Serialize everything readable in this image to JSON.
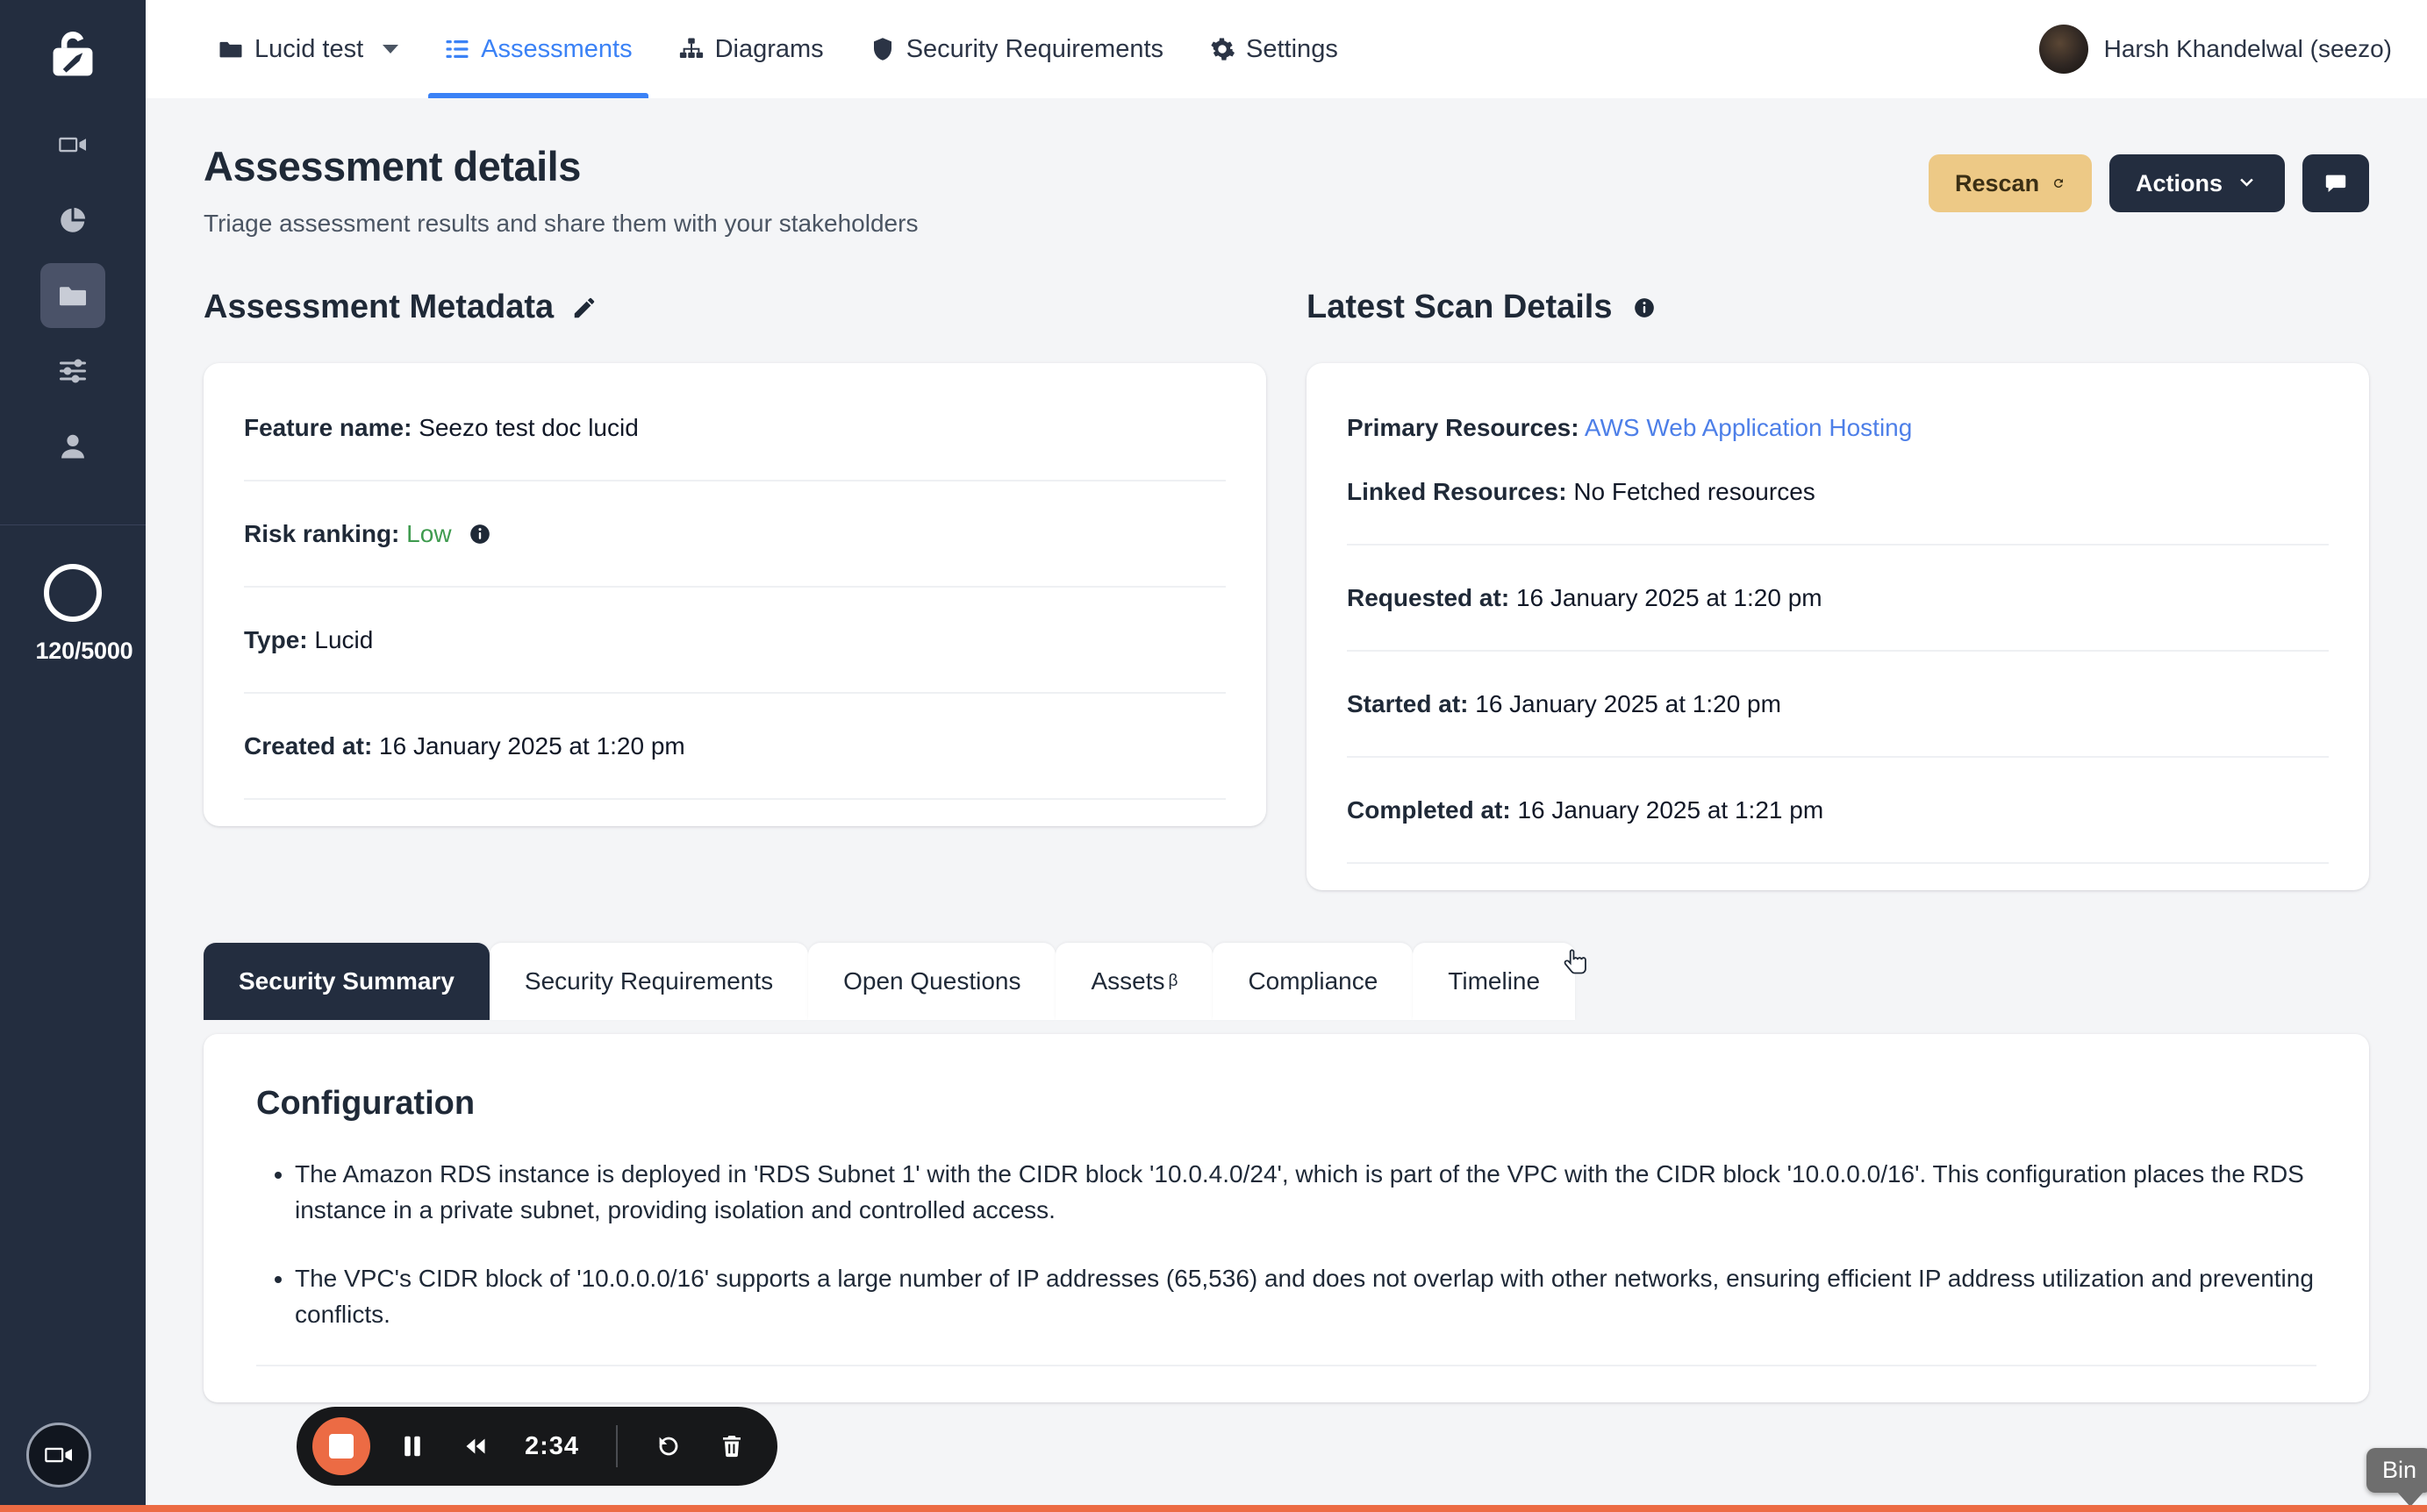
{
  "sidebar": {
    "logo_icon": "lock-compass-logo",
    "items": [
      {
        "icon": "video-camera-icon",
        "name": "recordings",
        "active": false
      },
      {
        "icon": "pie-chart-icon",
        "name": "analytics",
        "active": false
      },
      {
        "icon": "folder-icon",
        "name": "projects",
        "active": true
      },
      {
        "icon": "sliders-icon",
        "name": "settings-controls",
        "active": false
      },
      {
        "icon": "person-icon",
        "name": "account",
        "active": false
      }
    ],
    "quota_label": "120/5000"
  },
  "topbar": {
    "workspace": "Lucid test",
    "nav": [
      {
        "label": "Assessments",
        "icon": "list-icon",
        "active": true
      },
      {
        "label": "Diagrams",
        "icon": "sitemap-icon",
        "active": false
      },
      {
        "label": "Security Requirements",
        "icon": "shield-icon",
        "active": false
      },
      {
        "label": "Settings",
        "icon": "gear-icon",
        "active": false
      }
    ],
    "user_name": "Harsh Khandelwal (seezo)"
  },
  "page": {
    "title": "Assessment details",
    "subtitle": "Triage assessment results and share them with your stakeholders",
    "actions": {
      "rescan_label": "Rescan",
      "actions_label": "Actions",
      "chat_icon": "chat-bubble-icon"
    }
  },
  "metadata": {
    "heading": "Assessment Metadata",
    "edit_icon": "edit-pencil-icon",
    "rows": [
      {
        "label": "Feature name:",
        "value": "Seezo test doc lucid",
        "style": "plain"
      },
      {
        "label": "Risk ranking:",
        "value": "Low",
        "style": "low",
        "info": true
      },
      {
        "label": "Type:",
        "value": "Lucid",
        "style": "plain"
      },
      {
        "label": "Created at:",
        "value": "16 January 2025 at 1:20 pm",
        "style": "plain"
      }
    ]
  },
  "scan": {
    "heading": "Latest Scan Details",
    "info_icon": "info-icon",
    "rows": [
      {
        "label": "Primary Resources:",
        "value": "AWS Web Application Hosting",
        "style": "link"
      },
      {
        "label": "Linked Resources:",
        "value": "No Fetched resources",
        "style": "plain"
      },
      {
        "label": "Requested at:",
        "value": "16 January 2025 at 1:20 pm",
        "style": "plain"
      },
      {
        "label": "Started at:",
        "value": "16 January 2025 at 1:20 pm",
        "style": "plain"
      },
      {
        "label": "Completed at:",
        "value": "16 January 2025 at 1:21 pm",
        "style": "plain"
      }
    ]
  },
  "tabs": [
    {
      "label": "Security Summary",
      "active": true
    },
    {
      "label": "Security Requirements",
      "active": false
    },
    {
      "label": "Assets",
      "sup": "β",
      "active": false
    },
    {
      "label": "Open Questions",
      "active": false
    },
    {
      "label": "Compliance",
      "active": false
    },
    {
      "label": "Timeline",
      "active": false
    }
  ],
  "tab_order": [
    "Security Summary",
    "Security Requirements",
    "Open Questions",
    "Assets",
    "Compliance",
    "Timeline"
  ],
  "content": {
    "title": "Configuration",
    "bullets": [
      "The Amazon RDS instance is deployed in 'RDS Subnet 1' with the CIDR block '10.0.4.0/24', which is part of the VPC with the CIDR block '10.0.0.0/16'. This configuration places the RDS instance in a private subnet, providing isolation and controlled access.",
      "The VPC's CIDR block of '10.0.0.0/16' supports a large number of IP addresses (65,536) and does not overlap with other networks, ensuring efficient IP address utilization and preventing conflicts."
    ]
  },
  "recorder": {
    "stop_icon": "stop-icon",
    "pause_icon": "pause-icon",
    "rewind_icon": "rewind-icon",
    "time": "2:34",
    "restart_icon": "restart-icon",
    "delete_icon": "trash-icon",
    "tooltip": "Bin",
    "badge_icon": "video-camera-icon"
  },
  "colors": {
    "sidebar": "#232d3f",
    "accent_blue": "#3b82f6",
    "rescan": "#edc986",
    "dark": "#232d3f",
    "low_risk": "#3f9b4f",
    "link": "#4d7fe8",
    "record_orange": "#ec6b44"
  }
}
